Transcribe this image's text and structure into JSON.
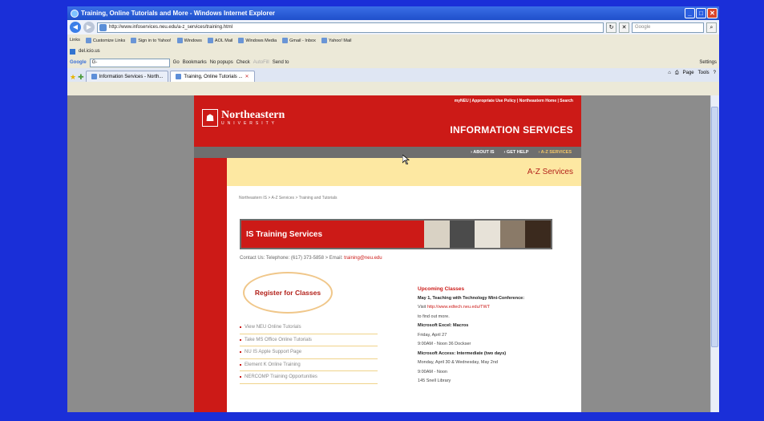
{
  "window": {
    "title": "Training, Online Tutorials and More - Windows Internet Explorer"
  },
  "address": {
    "url": "http://www.infoservices.neu.edu/a-z_services/training.html",
    "search_placeholder": "Google"
  },
  "links_bar": {
    "label": "Links",
    "items": [
      "Customize Links",
      "Sign in to Yahoo!",
      "Windows",
      "AOL Mail",
      "Windows Media",
      "Gmail - Inbox",
      "Yahoo! Mail"
    ]
  },
  "delicious": {
    "label": "del.icio.us"
  },
  "google_bar": {
    "label": "Google",
    "box": "G-",
    "go": "Go",
    "bookmarks": "Bookmarks",
    "popups": "No popups",
    "check": "Check",
    "autofill": "AutoFill",
    "send": "Send to",
    "settings": "Settings"
  },
  "tabs": [
    {
      "label": "Information Services - North..."
    },
    {
      "label": "Training, Online Tutorials ..."
    }
  ],
  "tab_tools": {
    "page": "Page",
    "tools": "Tools"
  },
  "site": {
    "top_links": "myNEU | Appropriate Use Policy | Northeastern Home | Search",
    "name": "Northeastern",
    "university": "UNIVERSITY",
    "section": "INFORMATION SERVICES",
    "nav": [
      "ABOUT IS",
      "GET HELP",
      "A-Z SERVICES"
    ],
    "band_title": "A-Z Services",
    "breadcrumb": "Northeastern IS > A-Z Services > Training and Tutorials",
    "banner_title": "IS Training Services",
    "contact_prefix": "Contact Us: Telephone: (617) 373-5858 > Email: ",
    "contact_email": "training@neu.edu",
    "register": "Register for Classes",
    "links": [
      "View NEU Online Tutorials",
      "Take MS Office Online Tutorials",
      "NU IS Apple Support Page",
      "Element K Online Training",
      "NERCOMP Training Opportunities"
    ],
    "upcoming": {
      "heading": "Upcoming Classes",
      "c1_title": "May 1, Teaching with Technology Mini-Conference:",
      "c1_visit": "Visit ",
      "c1_link": "http://www.edtech.neu.edu/TWT",
      "c1_more": "to find out more.",
      "c2_title": "Microsoft Excel: Macros",
      "c2_date": "Friday, April 27",
      "c2_time": "9:00AM - Noon 36 Dockser",
      "c3_title": "Microsoft Access: Intermediate (two days)",
      "c3_date": "Monday, April 30 & Wednesday, May 2nd",
      "c3_time": "9:00AM - Noon",
      "c3_place": "145 Snell Library"
    }
  },
  "colors": {
    "accent_red": "#cc1a17",
    "band_yellow": "#fde8a2",
    "slide_blue": "#1a2fd8"
  }
}
